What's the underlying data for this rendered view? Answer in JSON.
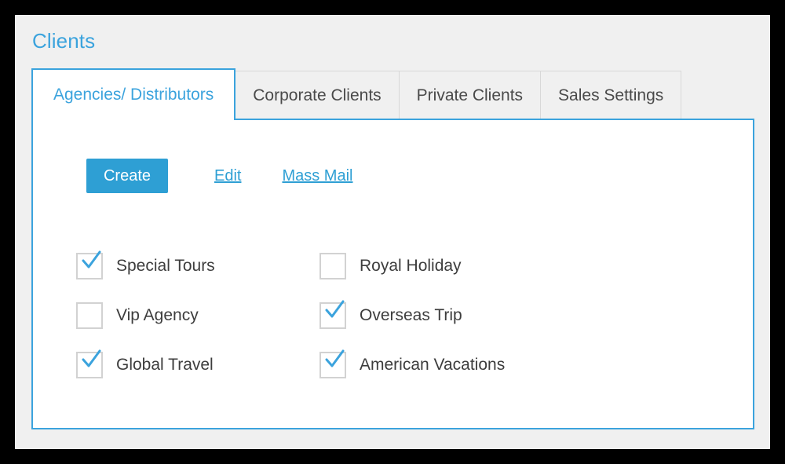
{
  "page": {
    "title": "Clients"
  },
  "tabs": [
    {
      "label": "Agencies/ Distributors",
      "active": true
    },
    {
      "label": "Corporate Clients",
      "active": false
    },
    {
      "label": "Private Clients",
      "active": false
    },
    {
      "label": "Sales Settings",
      "active": false
    }
  ],
  "toolbar": {
    "create_label": "Create",
    "edit_label": "Edit",
    "mass_mail_label": "Mass Mail"
  },
  "client_list": {
    "columns": [
      [
        {
          "label": "Special Tours",
          "checked": true
        },
        {
          "label": "Vip Agency",
          "checked": false
        },
        {
          "label": "Global Travel",
          "checked": true
        }
      ],
      [
        {
          "label": "Royal Holiday",
          "checked": false
        },
        {
          "label": "Overseas Trip",
          "checked": true
        },
        {
          "label": "American Vacations",
          "checked": true
        }
      ]
    ]
  },
  "colors": {
    "accent": "#3ba3dd",
    "button": "#2e9fd4",
    "checkmark": "#3ba3dd",
    "surface": "#f0f0f0",
    "panel": "#ffffff",
    "frame": "#000000",
    "text": "#3d3d3d",
    "tab_inactive_text": "#4a4a4a",
    "checkbox_border": "#d2d2d2"
  }
}
